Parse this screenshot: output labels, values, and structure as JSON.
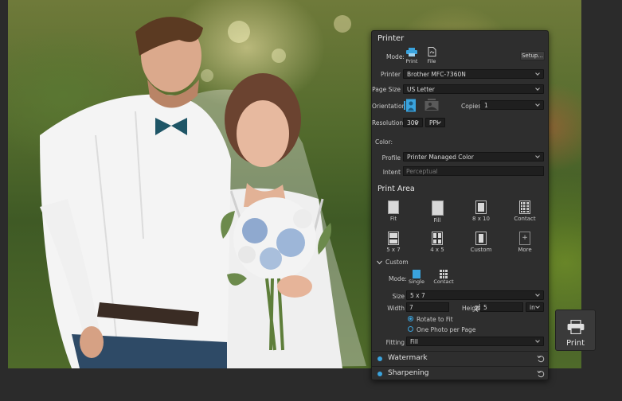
{
  "panel": {
    "title": "Printer",
    "mode_label": "Mode:",
    "mode_print": "Print",
    "mode_file": "File",
    "setup_label": "Setup...",
    "printer_label": "Printer",
    "printer_value": "Brother MFC-7360N",
    "page_size_label": "Page Size",
    "page_size_value": "US Letter",
    "orientation_label": "Orientation",
    "copies_label": "Copies",
    "copies_value": "1",
    "resolution_label": "Resolution",
    "resolution_value": "300",
    "resolution_unit": "PPI",
    "color_label": "Color:",
    "profile_label": "Profile",
    "profile_value": "Printer Managed Color",
    "intent_label": "Intent",
    "intent_value": "Perceptual"
  },
  "print_area": {
    "title": "Print Area",
    "tiles": [
      "Fit",
      "Fill",
      "8 x 10",
      "Contact",
      "5 x 7",
      "4 x 5",
      "Custom",
      "More"
    ],
    "custom_label": "Custom",
    "mode_label": "Mode:",
    "mode_single": "Single",
    "mode_contact": "Contact",
    "size_label": "Size",
    "size_value": "5 x 7",
    "width_label": "Width",
    "width_value": "7",
    "height_label": "Height",
    "height_value": "5",
    "unit_value": "in",
    "rotate_label": "Rotate to Fit",
    "one_photo_label": "One Photo per Page",
    "fitting_label": "Fitting",
    "fitting_value": "Fill"
  },
  "sections": {
    "watermark": "Watermark",
    "sharpening": "Sharpening"
  },
  "print_button": {
    "label": "Print"
  },
  "colors": {
    "accent": "#3aa3dd",
    "panel_bg": "#2e2e2e",
    "field_bg": "#1f1f1f"
  }
}
